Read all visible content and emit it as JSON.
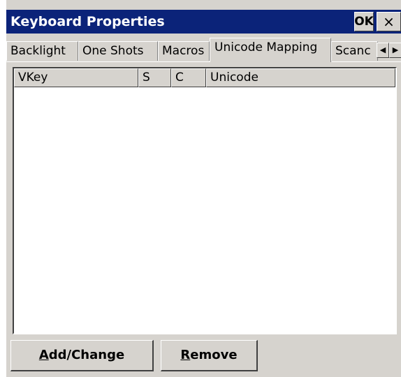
{
  "window": {
    "title": "Keyboard Properties",
    "ok_label": "OK",
    "close_label": "×"
  },
  "tabs": [
    {
      "label": "Backlight"
    },
    {
      "label": "One Shots"
    },
    {
      "label": "Macros"
    },
    {
      "label": "Unicode Mapping",
      "active": true
    },
    {
      "label": "Scanc"
    }
  ],
  "tab_scroll": {
    "left_icon": "triangle-left-icon",
    "right_icon": "triangle-right-icon"
  },
  "list": {
    "columns": [
      "VKey",
      "S",
      "C",
      "Unicode"
    ],
    "rows": []
  },
  "buttons": {
    "add_change": {
      "mnemonic": "A",
      "rest": "dd/Change"
    },
    "remove": {
      "mnemonic": "R",
      "rest": "emove"
    }
  }
}
